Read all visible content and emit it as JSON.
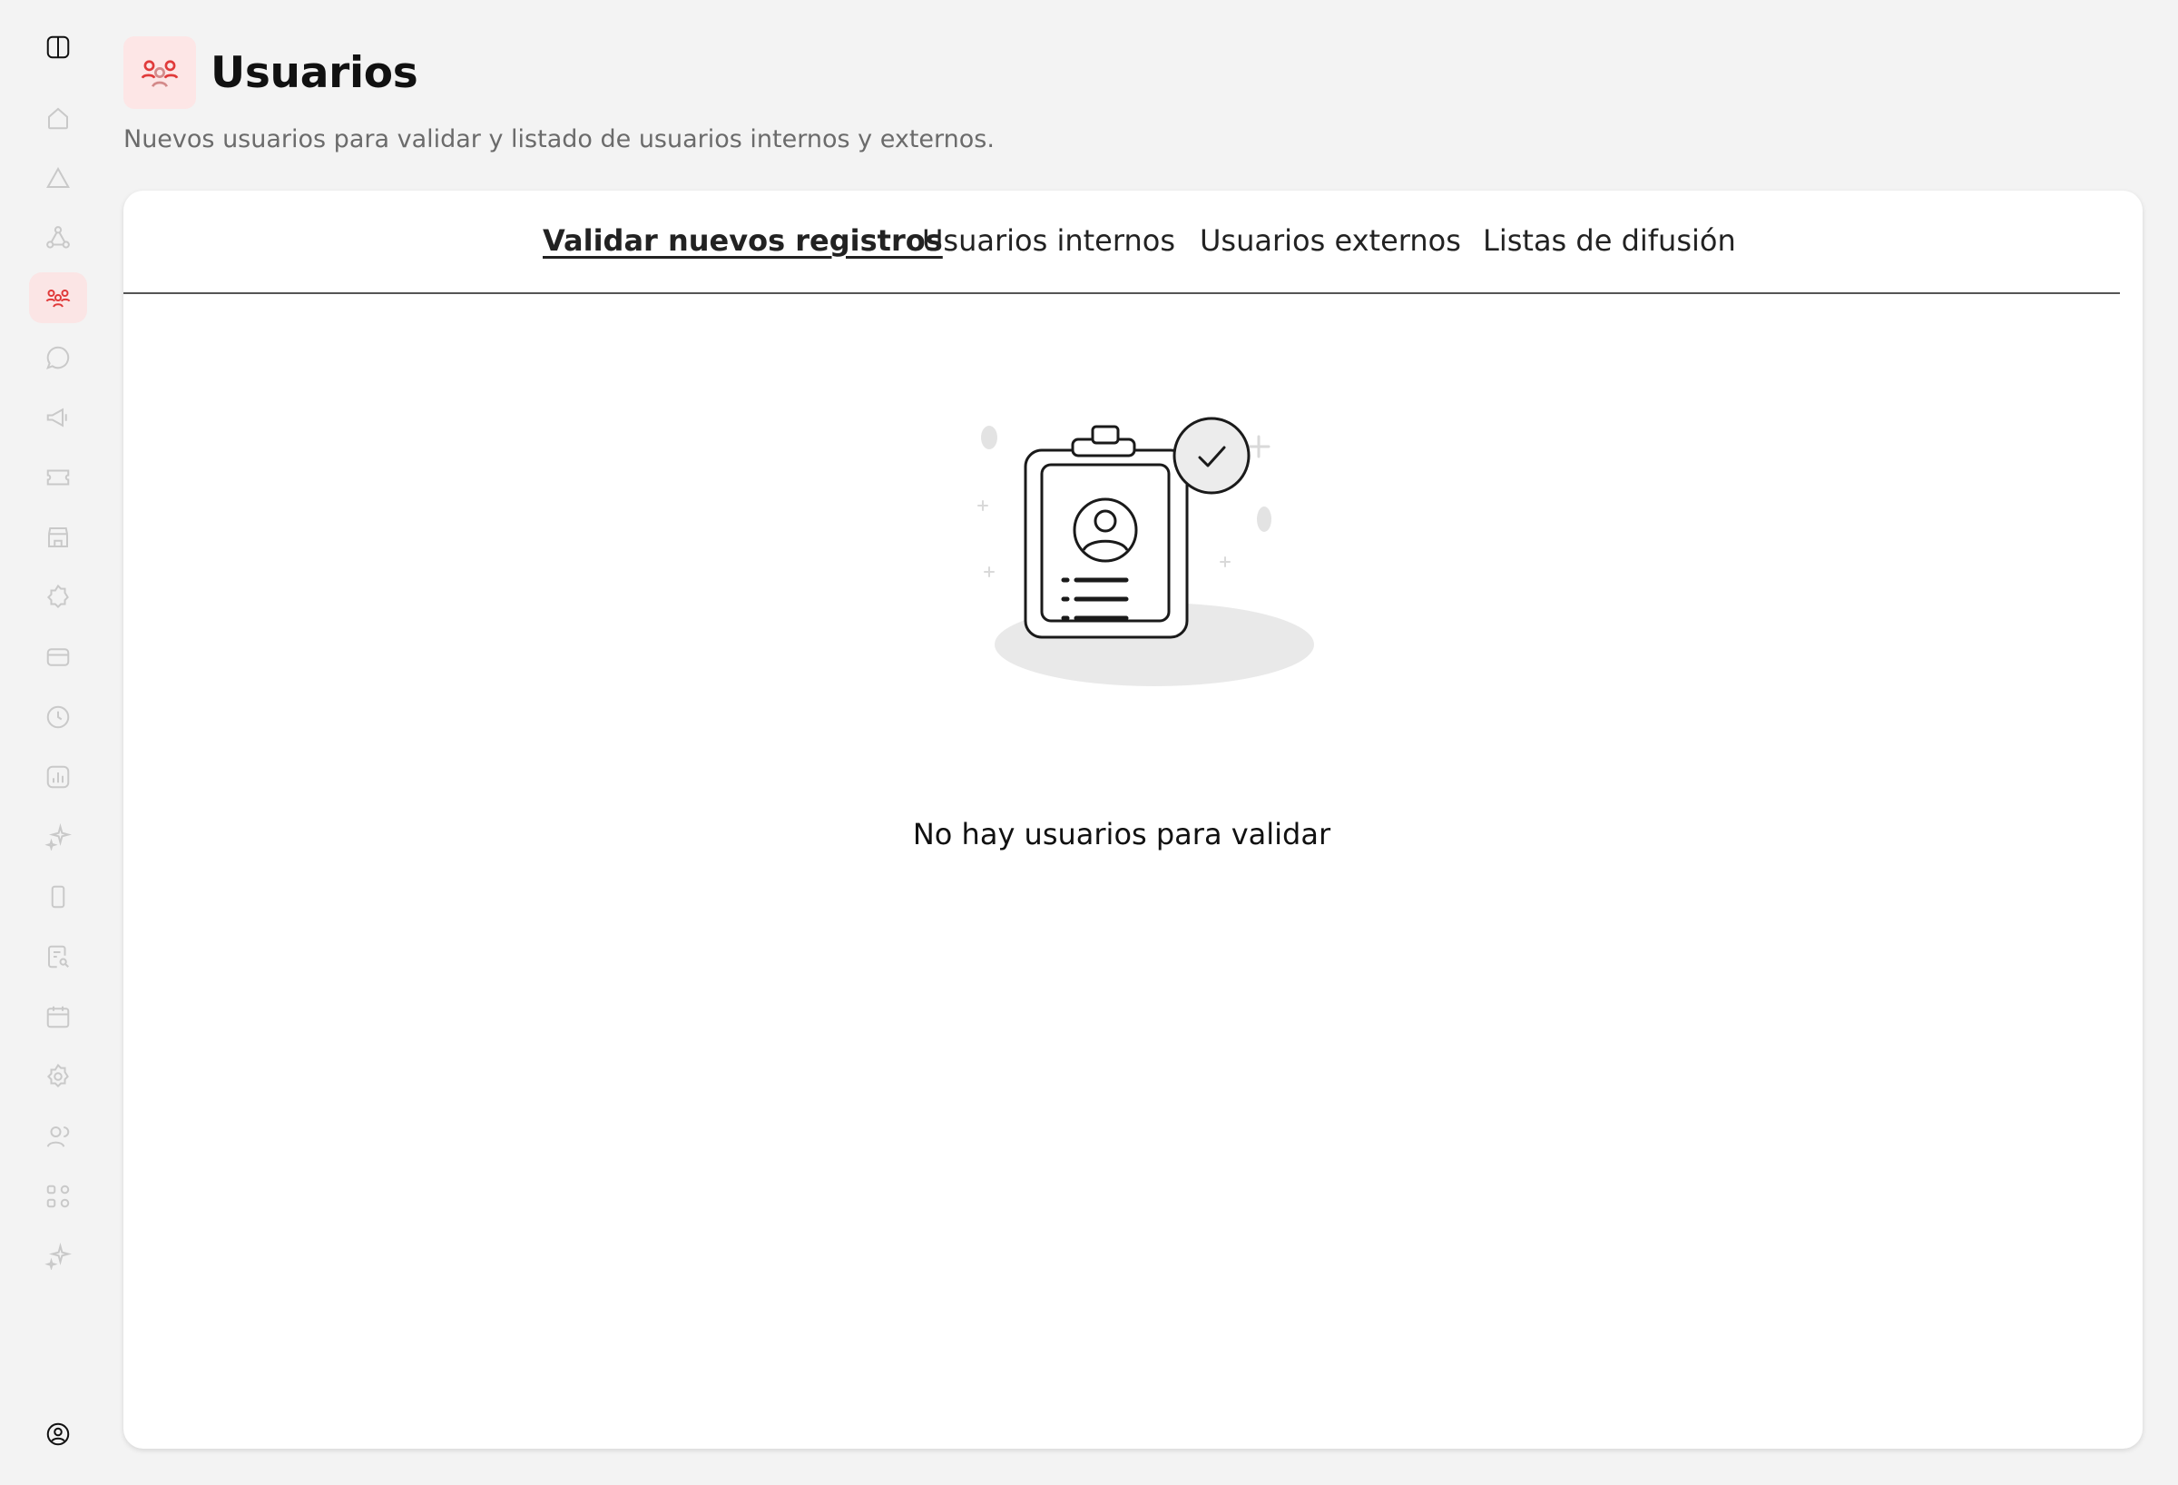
{
  "sidebar": {
    "items": [
      {
        "icon": "panel-toggle-icon"
      },
      {
        "icon": "home-icon"
      },
      {
        "icon": "alert-triangle-icon"
      },
      {
        "icon": "network-icon"
      },
      {
        "icon": "users-icon",
        "active": true
      },
      {
        "icon": "chat-icon"
      },
      {
        "icon": "megaphone-icon"
      },
      {
        "icon": "ticket-icon"
      },
      {
        "icon": "store-icon"
      },
      {
        "icon": "badge-icon"
      },
      {
        "icon": "card-icon"
      },
      {
        "icon": "clock-icon"
      },
      {
        "icon": "analytics-icon"
      },
      {
        "icon": "sparkle-icon"
      },
      {
        "icon": "mobile-icon"
      },
      {
        "icon": "document-search-icon"
      },
      {
        "icon": "calendar-icon"
      },
      {
        "icon": "settings-icon"
      },
      {
        "icon": "user-icon"
      },
      {
        "icon": "workflow-icon"
      },
      {
        "icon": "sparkle-icon"
      },
      {
        "icon": "account-icon"
      }
    ],
    "accent": "#e03a3a",
    "icon_color": "#c9c9c9"
  },
  "header": {
    "title": "Usuarios",
    "subtitle": "Nuevos usuarios para validar y listado de usuarios internos y externos.",
    "icon": "users-icon"
  },
  "tabs": [
    {
      "label": "Validar nuevos registros",
      "active": true
    },
    {
      "label": "Usuarios internos",
      "active": false
    },
    {
      "label": "Usuarios externos",
      "active": false
    },
    {
      "label": "Listas de difusión",
      "active": false
    }
  ],
  "empty_state": {
    "message": "No hay usuarios para validar",
    "illustration": "id-badge-check-icon"
  }
}
